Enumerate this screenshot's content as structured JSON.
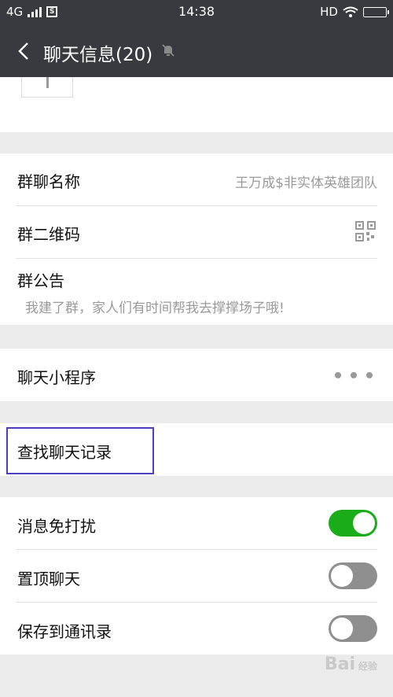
{
  "status_bar": {
    "network": "4G",
    "carrier_icon": "S",
    "time": "14:38",
    "hd": "HD"
  },
  "header": {
    "title": "聊天信息(20)"
  },
  "group_info": {
    "name_label": "群聊名称",
    "name_value": "王万成$非实体英雄团队",
    "qr_label": "群二维码",
    "notice_label": "群公告",
    "notice_text": "我建了群，家人们有时间帮我去撑撑场子哦!"
  },
  "mini_program": {
    "label": "聊天小程序"
  },
  "search_history": {
    "label": "查找聊天记录"
  },
  "settings": {
    "mute_label": "消息免打扰",
    "mute_on": true,
    "sticky_label": "置顶聊天",
    "sticky_on": false,
    "save_contacts_label": "保存到通讯录",
    "save_contacts_on": false
  },
  "watermark": {
    "text": "Bai",
    "sub": "经验"
  }
}
